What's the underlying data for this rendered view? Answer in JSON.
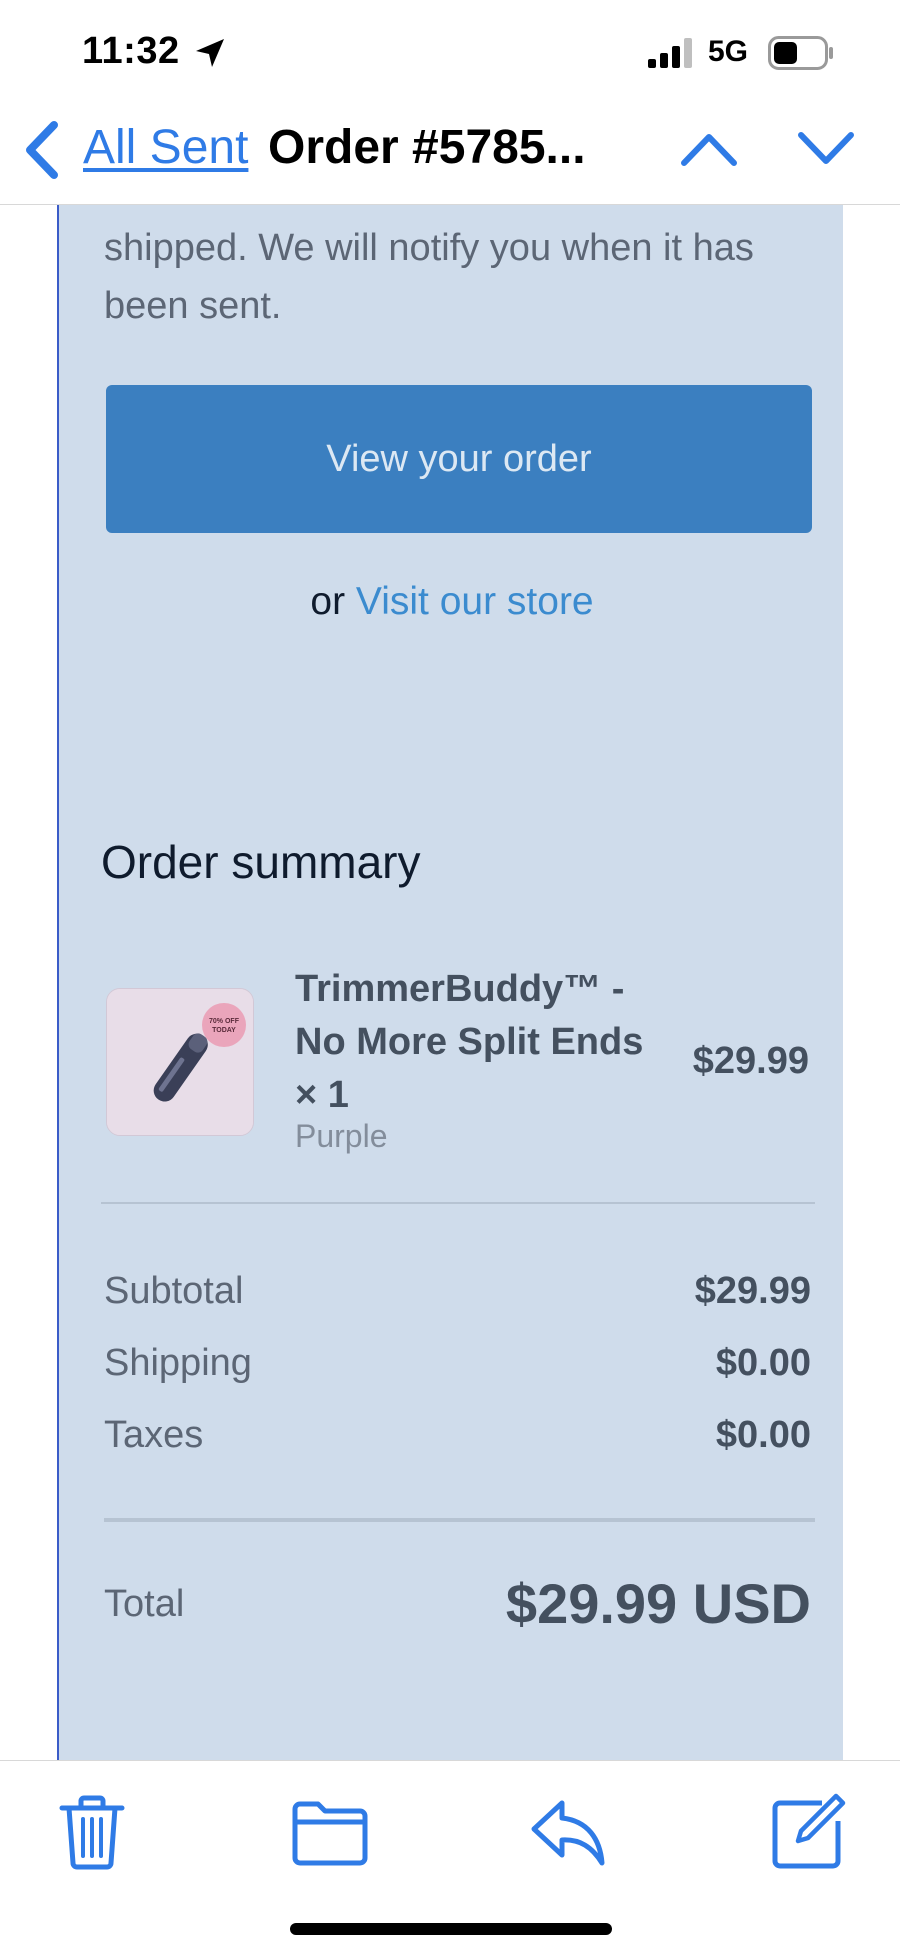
{
  "status_bar": {
    "time": "11:32",
    "network": "5G"
  },
  "nav": {
    "back_label": "All Sent",
    "title": "Order #5785..."
  },
  "email": {
    "intro_text": "shipped. We will notify you when it has been sent.",
    "view_order_label": "View your order",
    "or_text": "or",
    "visit_store_label": "Visit our store",
    "order_summary_title": "Order summary",
    "product": {
      "name": "TrimmerBuddy™ - No More Split Ends × 1",
      "variant": "Purple",
      "price": "$29.99",
      "thumb_badge_line1": "70% OFF",
      "thumb_badge_line2": "TODAY"
    },
    "totals": {
      "subtotal_label": "Subtotal",
      "subtotal_value": "$29.99",
      "shipping_label": "Shipping",
      "shipping_value": "$0.00",
      "taxes_label": "Taxes",
      "taxes_value": "$0.00",
      "total_label": "Total",
      "total_value": "$29.99 USD"
    }
  },
  "toolbar": [
    "trash-icon",
    "folder-icon",
    "reply-icon",
    "compose-icon"
  ],
  "colors": {
    "accent": "#2f7be6",
    "button": "#3b7fc0",
    "email_bg": "#cfdceb"
  }
}
